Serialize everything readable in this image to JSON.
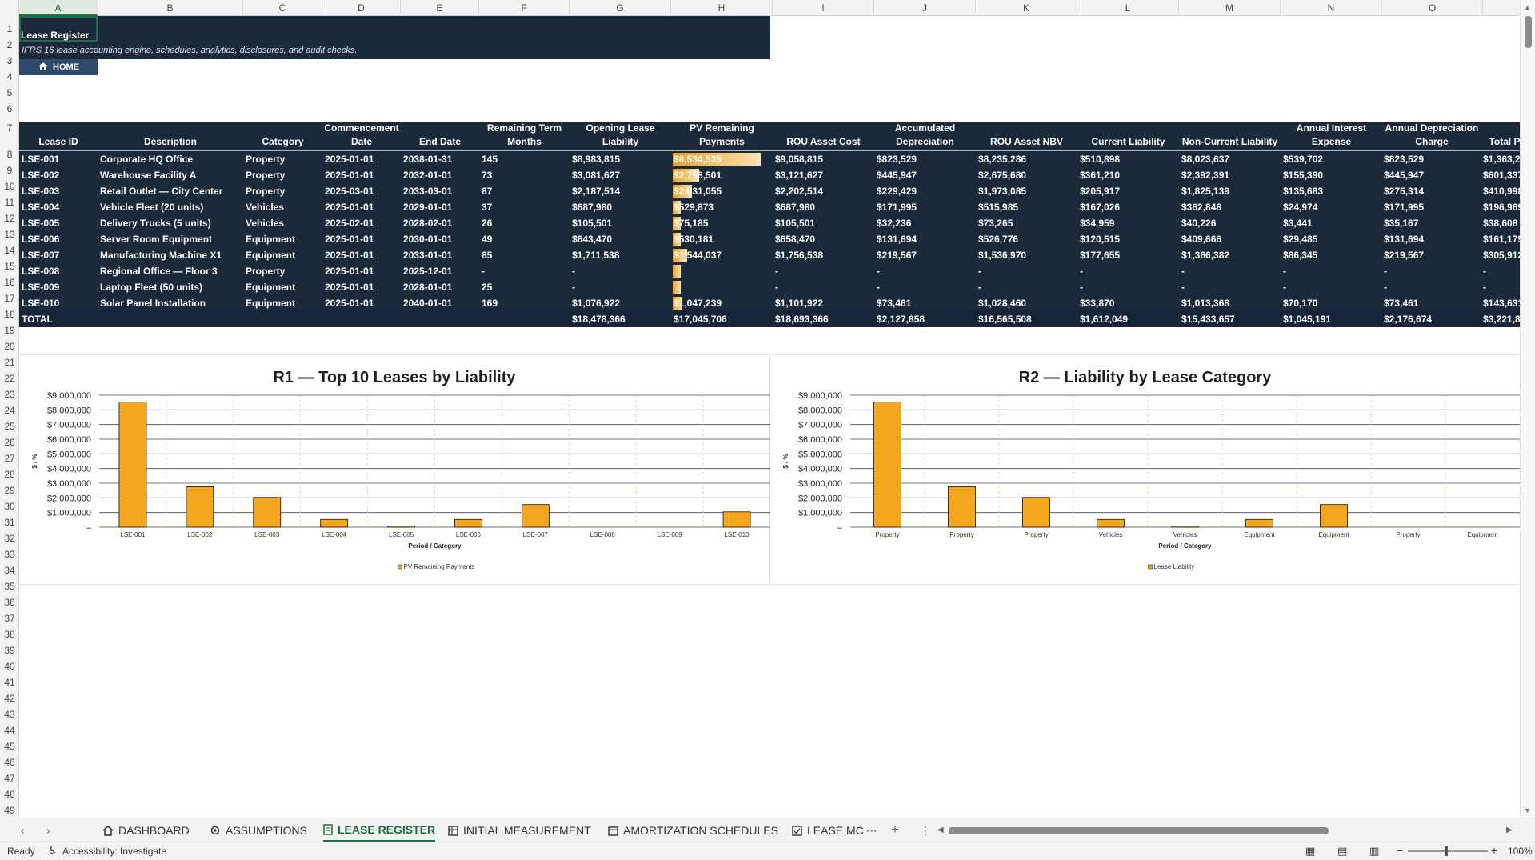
{
  "sheet": {
    "title": "Lease Register",
    "subtitle": "IFRS 16 lease accounting engine, schedules, analytics, disclosures, and audit checks.",
    "home_label": "HOME"
  },
  "columns": [
    "A",
    "B",
    "C",
    "D",
    "E",
    "F",
    "G",
    "H",
    "I",
    "J",
    "K",
    "L",
    "M",
    "N",
    "O"
  ],
  "rows": [
    "1",
    "2",
    "3",
    "4",
    "5",
    "6",
    "7",
    "8",
    "9",
    "10",
    "11",
    "12",
    "13",
    "14",
    "15",
    "16",
    "17",
    "18",
    "19",
    "20",
    "21",
    "22",
    "23",
    "24",
    "25",
    "26",
    "27",
    "28",
    "29",
    "30",
    "31",
    "32",
    "33",
    "34",
    "35",
    "36",
    "37",
    "38",
    "39",
    "40",
    "41",
    "42",
    "43",
    "44",
    "45",
    "46",
    "47",
    "48",
    "49"
  ],
  "table": {
    "headers": [
      "Lease ID",
      "Description",
      "Category",
      "Commencement Date",
      "End Date",
      "Remaining Term Months",
      "Opening Lease Liability",
      "PV Remaining Payments",
      "ROU Asset Cost",
      "Accumulated Depreciation",
      "ROU Asset NBV",
      "Current Liability",
      "Non-Current Liability",
      "Annual Interest Expense",
      "Annual Depreciation Charge",
      "Total P"
    ],
    "header_lines": [
      [
        "",
        "Lease ID"
      ],
      [
        "",
        "Description"
      ],
      [
        "",
        "Category"
      ],
      [
        "Commencement",
        "Date"
      ],
      [
        "",
        "End Date"
      ],
      [
        "Remaining Term",
        "Months"
      ],
      [
        "Opening Lease",
        "Liability"
      ],
      [
        "PV Remaining",
        "Payments"
      ],
      [
        "",
        "ROU Asset Cost"
      ],
      [
        "Accumulated",
        "Depreciation"
      ],
      [
        "",
        "ROU Asset NBV"
      ],
      [
        "",
        "Current Liability"
      ],
      [
        "",
        "Non-Current Liability"
      ],
      [
        "Annual Interest",
        "Expense"
      ],
      [
        "Annual Depreciation",
        "Charge"
      ],
      [
        "",
        "Total P"
      ]
    ],
    "pv_fraction": [
      1.0,
      0.3,
      0.22,
      0.07,
      0.01,
      0.05,
      0.16,
      0.0,
      0.0,
      0.11
    ],
    "rows": [
      [
        "LSE-001",
        "Corporate HQ Office",
        "Property",
        "2025-01-01",
        "2038-01-31",
        "145",
        "$8,983,815",
        "$8,534,535",
        "$9,058,815",
        "$823,529",
        "$8,235,286",
        "$510,898",
        "$8,023,637",
        "$539,702",
        "$823,529",
        "$1,363,2"
      ],
      [
        "LSE-002",
        "Warehouse Facility A",
        "Property",
        "2025-01-01",
        "2032-01-01",
        "73",
        "$3,081,627",
        "$2,758,501",
        "$3,121,627",
        "$445,947",
        "$2,675,680",
        "$361,210",
        "$2,392,391",
        "$155,390",
        "$445,947",
        "$601,337"
      ],
      [
        "LSE-003",
        "Retail Outlet — City Center",
        "Property",
        "2025-03-01",
        "2033-03-01",
        "87",
        "$2,187,514",
        "$2,031,055",
        "$2,202,514",
        "$229,429",
        "$1,973,085",
        "$205,917",
        "$1,825,139",
        "$135,683",
        "$275,314",
        "$410,998"
      ],
      [
        "LSE-004",
        "Vehicle Fleet (20 units)",
        "Vehicles",
        "2025-01-01",
        "2029-01-01",
        "37",
        "$687,980",
        "$529,873",
        "$687,980",
        "$171,995",
        "$515,985",
        "$167,026",
        "$362,848",
        "$24,974",
        "$171,995",
        "$196,969"
      ],
      [
        "LSE-005",
        "Delivery Trucks (5 units)",
        "Vehicles",
        "2025-02-01",
        "2028-02-01",
        "26",
        "$105,501",
        "$75,185",
        "$105,501",
        "$32,236",
        "$73,265",
        "$34,959",
        "$40,226",
        "$3,441",
        "$35,167",
        "$38,608"
      ],
      [
        "LSE-006",
        "Server Room Equipment",
        "Equipment",
        "2025-01-01",
        "2030-01-01",
        "49",
        "$643,470",
        "$530,181",
        "$658,470",
        "$131,694",
        "$526,776",
        "$120,515",
        "$409,666",
        "$29,485",
        "$131,694",
        "$161,179"
      ],
      [
        "LSE-007",
        "Manufacturing Machine X1",
        "Equipment",
        "2025-01-01",
        "2033-01-01",
        "85",
        "$1,711,538",
        "$1,544,037",
        "$1,756,538",
        "$219,567",
        "$1,536,970",
        "$177,655",
        "$1,366,382",
        "$86,345",
        "$219,567",
        "$305,912"
      ],
      [
        "LSE-008",
        "Regional Office — Floor 3",
        "Property",
        "2025-01-01",
        "2025-12-01",
        "-",
        "-",
        "",
        "-",
        "-",
        "-",
        "-",
        "-",
        "-",
        "-",
        "-"
      ],
      [
        "LSE-009",
        "Laptop Fleet (50 units)",
        "Equipment",
        "2025-01-01",
        "2028-01-01",
        "25",
        "-",
        "",
        "-",
        "-",
        "-",
        "-",
        "-",
        "-",
        "-",
        "-"
      ],
      [
        "LSE-010",
        "Solar Panel Installation",
        "Equipment",
        "2025-01-01",
        "2040-01-01",
        "169",
        "$1,076,922",
        "$1,047,239",
        "$1,101,922",
        "$73,461",
        "$1,028,460",
        "$33,870",
        "$1,013,368",
        "$70,170",
        "$73,461",
        "$143,631"
      ]
    ],
    "total": [
      "TOTAL",
      "",
      "",
      "",
      "",
      "",
      "$18,478,366",
      "$17,045,706",
      "$18,693,366",
      "$2,127,858",
      "$16,565,508",
      "$1,612,049",
      "$15,433,657",
      "$1,045,191",
      "$2,176,674",
      "$3,221,8"
    ]
  },
  "chart_data": [
    {
      "type": "bar",
      "title": "R1 — Top 10 Leases by Liability",
      "xlabel": "Period / Category",
      "ylabel": "$ / %",
      "categories": [
        "LSE-001",
        "LSE-002",
        "LSE-003",
        "LSE-004",
        "LSE-005",
        "LSE-006",
        "LSE-007",
        "LSE-008",
        "LSE-009",
        "LSE-010"
      ],
      "series": [
        {
          "name": "PV Remaining Payments",
          "values": [
            8534535,
            2758501,
            2031055,
            529873,
            75185,
            530181,
            1544037,
            0,
            0,
            1047239
          ]
        }
      ],
      "ylim": [
        0,
        9000000
      ],
      "yticks": [
        "–",
        "$1,000,000",
        "$2,000,000",
        "$3,000,000",
        "$4,000,000",
        "$5,000,000",
        "$6,000,000",
        "$7,000,000",
        "$8,000,000",
        "$9,000,000"
      ],
      "legend": "bottom",
      "color": "#f4a71e"
    },
    {
      "type": "bar",
      "title": "R2 — Liability by Lease Category",
      "xlabel": "Period / Category",
      "ylabel": "$ / %",
      "categories": [
        "Property",
        "Property",
        "Property",
        "Vehicles",
        "Vehicles",
        "Equipment",
        "Equipment",
        "Property",
        "Equipment"
      ],
      "series": [
        {
          "name": "Lease Liability",
          "values": [
            8534535,
            2758501,
            2031055,
            529873,
            75185,
            530181,
            1544037,
            0,
            0
          ]
        }
      ],
      "ylim": [
        0,
        9000000
      ],
      "yticks": [
        "–",
        "$1,000,000",
        "$2,000,000",
        "$3,000,000",
        "$4,000,000",
        "$5,000,000",
        "$6,000,000",
        "$7,000,000",
        "$8,000,000",
        "$9,000,000"
      ],
      "legend": "bottom",
      "color": "#f4a71e"
    }
  ],
  "tabs": [
    {
      "label": "DASHBOARD",
      "icon": "home-icon"
    },
    {
      "label": "ASSUMPTIONS",
      "icon": "gear-icon"
    },
    {
      "label": "LEASE REGISTER",
      "icon": "document-icon",
      "active": true
    },
    {
      "label": "INITIAL MEASUREMENT",
      "icon": "table-icon"
    },
    {
      "label": "AMORTIZATION SCHEDULES",
      "icon": "calendar-icon"
    },
    {
      "label": "LEASE MC",
      "icon": "check-icon"
    }
  ],
  "status": {
    "ready": "Ready",
    "accessibility": "Accessibility: Investigate",
    "zoom": "100%"
  },
  "colors": {
    "navy": "#1b2a3b",
    "accent": "#1e7145",
    "bar": "#f4a71e"
  }
}
